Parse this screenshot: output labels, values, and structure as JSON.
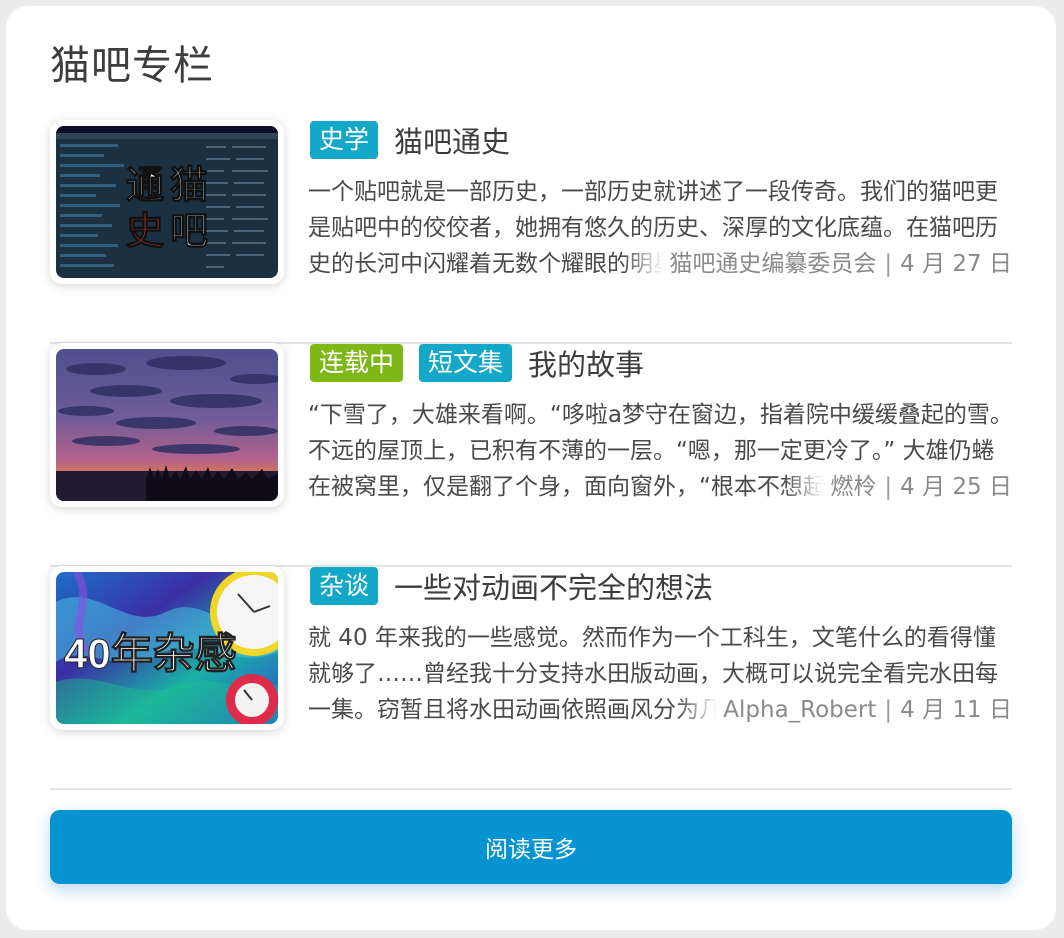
{
  "section": {
    "title": "猫吧专栏"
  },
  "articles": [
    {
      "tags": [
        {
          "label": "史学",
          "color": "#13a7c8"
        }
      ],
      "title": "猫吧通史",
      "excerpt": "一个贴吧就是一部历史，一部历史就讲述了一段传奇。我们的猫吧更是贴吧中的佼佼者，她拥有悠久的历史、深厚的文化底蕴。在猫吧历史的长河中闪耀着无数个耀眼的明星。",
      "author": "猫吧通史编纂委员会",
      "date": "4 月 27 日",
      "thumbnail": {
        "icon": "history-cover-image",
        "text": [
          "通",
          "猫",
          "史",
          "吧"
        ]
      }
    },
    {
      "tags": [
        {
          "label": "连载中",
          "color": "#7db718"
        },
        {
          "label": "短文集",
          "color": "#13a7c8"
        }
      ],
      "title": "我的故事",
      "excerpt": "“下雪了，大雄来看啊。“哆啦a梦守在窗边，指着院中缓缓叠起的雪。不远的屋顶上，已积有不薄的一层。“嗯，那一定更冷了。” 大雄仍蜷在被窝里，仅是翻了个身，面向窗外，“根本不想起来呢。”",
      "author": "燃柃",
      "date": "4 月 25 日",
      "thumbnail": {
        "icon": "sunset-sky-image"
      }
    },
    {
      "tags": [
        {
          "label": "杂谈",
          "color": "#13a7c8"
        }
      ],
      "title": "一些对动画不完全的想法",
      "excerpt": "就 40 年来我的一些感觉。然而作为一个工科生，文笔什么的看得懂就够了……曾经我十分支持水田版动画，大概可以说完全看完水田每一集。窃暂且将水田动画依照画风分为几个时期。",
      "author": "Alpha_Robert",
      "date": "4 月 11 日",
      "thumbnail": {
        "icon": "clock-collage-image",
        "text": [
          "40年杂感"
        ]
      }
    }
  ],
  "read_more": {
    "label": "阅读更多"
  },
  "colors": {
    "button": "#0693d2",
    "tag_blue": "#13a7c8",
    "tag_green": "#7db718"
  }
}
